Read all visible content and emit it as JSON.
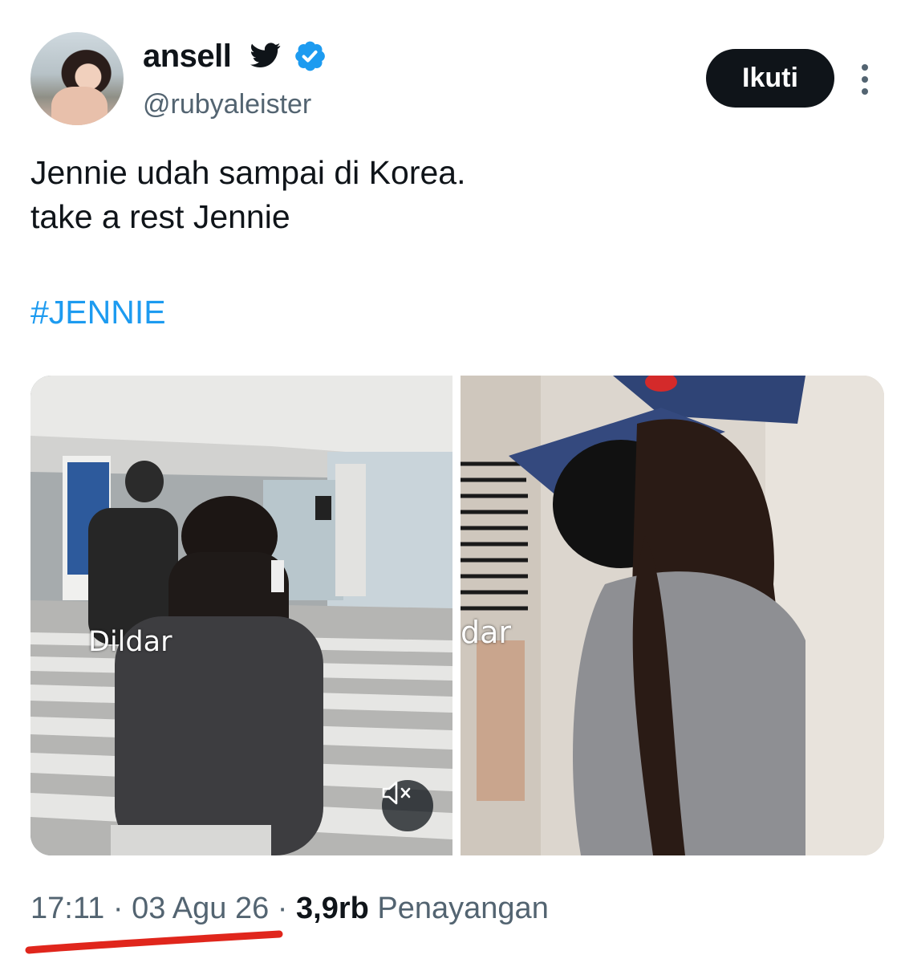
{
  "author": {
    "display_name": "ansell",
    "handle": "@rubyaleister",
    "bird_icon": "twitter-bird-icon",
    "verified_icon": "verified-badge-icon",
    "verified_color": "#1d9bf0"
  },
  "follow_button": {
    "label": "Ikuti"
  },
  "more_icon": "more-vertical-icon",
  "tweet": {
    "line1": "Jennie udah sampai di Korea.",
    "line2": "take a rest Jennie",
    "hashtag": "#JENNIE"
  },
  "media": {
    "left_caption": "Dildar",
    "right_caption": "dar",
    "mute_icon": "volume-muted-icon"
  },
  "meta": {
    "time": "17:11",
    "date": "03 Agu 26",
    "views_count": "3,9rb",
    "views_label": "Penayangan",
    "separator": "·"
  },
  "colors": {
    "link": "#1d9bf0",
    "secondary_text": "#536471",
    "annotation": "#e0261c"
  }
}
